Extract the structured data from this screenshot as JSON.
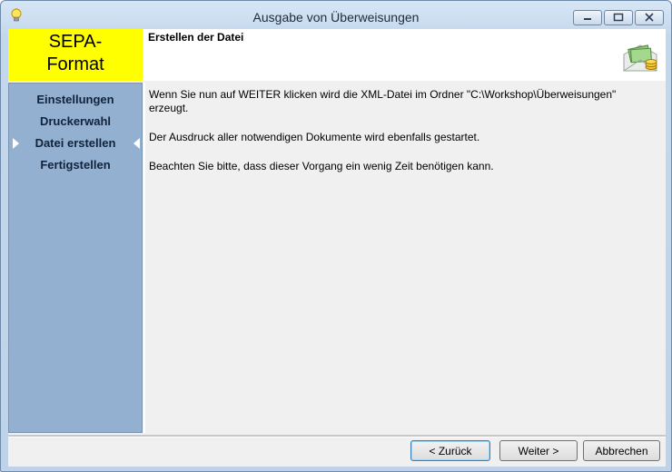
{
  "window": {
    "title": "Ausgabe von Überweisungen",
    "icon": "lightbulb-icon",
    "controls": [
      "minimize-icon",
      "maximize-icon",
      "close-icon"
    ]
  },
  "banner": {
    "format_label": "SEPA-Format",
    "format_line1": "SEPA-",
    "format_line2": "Format",
    "format_bg": "#ffff00",
    "step_title": "Erstellen der Datei",
    "icon": "money-envelope-icon"
  },
  "sidebar": {
    "bg": "#93b0d1",
    "items": [
      {
        "label": "Einstellungen",
        "active": false
      },
      {
        "label": "Druckerwahl",
        "active": false
      },
      {
        "label": "Datei erstellen",
        "active": true
      },
      {
        "label": "Fertigstellen",
        "active": false
      }
    ]
  },
  "content": {
    "paragraphs": [
      "Wenn Sie nun auf WEITER klicken wird die XML-Datei im Ordner \"C:\\Workshop\\Überweisungen\" erzeugt.",
      "Der Ausdruck aller notwendigen Dokumente wird ebenfalls gestartet.",
      "Beachten Sie bitte, dass dieser Vorgang ein wenig Zeit benötigen kann."
    ]
  },
  "buttons": {
    "back": "< Zurück",
    "next": "Weiter >",
    "cancel": "Abbrechen"
  }
}
